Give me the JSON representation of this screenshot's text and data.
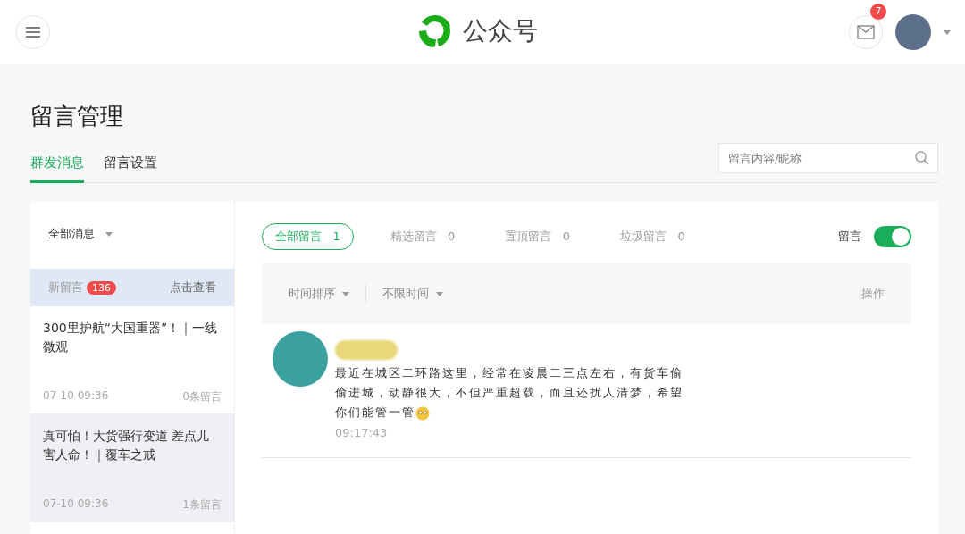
{
  "header": {
    "title": "公众号",
    "mail_badge": "7"
  },
  "page": {
    "title": "留言管理"
  },
  "tabs": [
    {
      "label": "群发消息",
      "selected": true
    },
    {
      "label": "留言设置",
      "selected": false
    }
  ],
  "search": {
    "placeholder": "留言内容/昵称"
  },
  "sidebar": {
    "filter": "全部消息",
    "new_comments": {
      "label": "新留言",
      "count": "136",
      "link": "点击查看"
    },
    "articles": [
      {
        "title": "300里护航“大国重器”！｜一线微观",
        "date": "07-10 09:36",
        "comments": "0条留言",
        "selected": false
      },
      {
        "title": "真可怕！大货强行变道 差点儿害人命！｜覆车之戒",
        "date": "07-10 09:36",
        "comments": "1条留言",
        "selected": true
      }
    ]
  },
  "comment_tabs": [
    {
      "label": "全部留言",
      "count": "1",
      "selected": true
    },
    {
      "label": "精选留言",
      "count": "0",
      "selected": false
    },
    {
      "label": "置顶留言",
      "count": "0",
      "selected": false
    },
    {
      "label": "垃圾留言",
      "count": "0",
      "selected": false
    }
  ],
  "toggle": {
    "label": "留言",
    "on": true
  },
  "table_header": {
    "sort": "时间排序",
    "time_range": "不限时间",
    "actions": "操作"
  },
  "comments": [
    {
      "text": "最近在城区二环路这里，经常在凌晨二三点左右，有货车偷偷进城，动静很大，不但严重超载，而且还扰人清梦，希望你们能管一管",
      "time": "09:17:43"
    }
  ]
}
